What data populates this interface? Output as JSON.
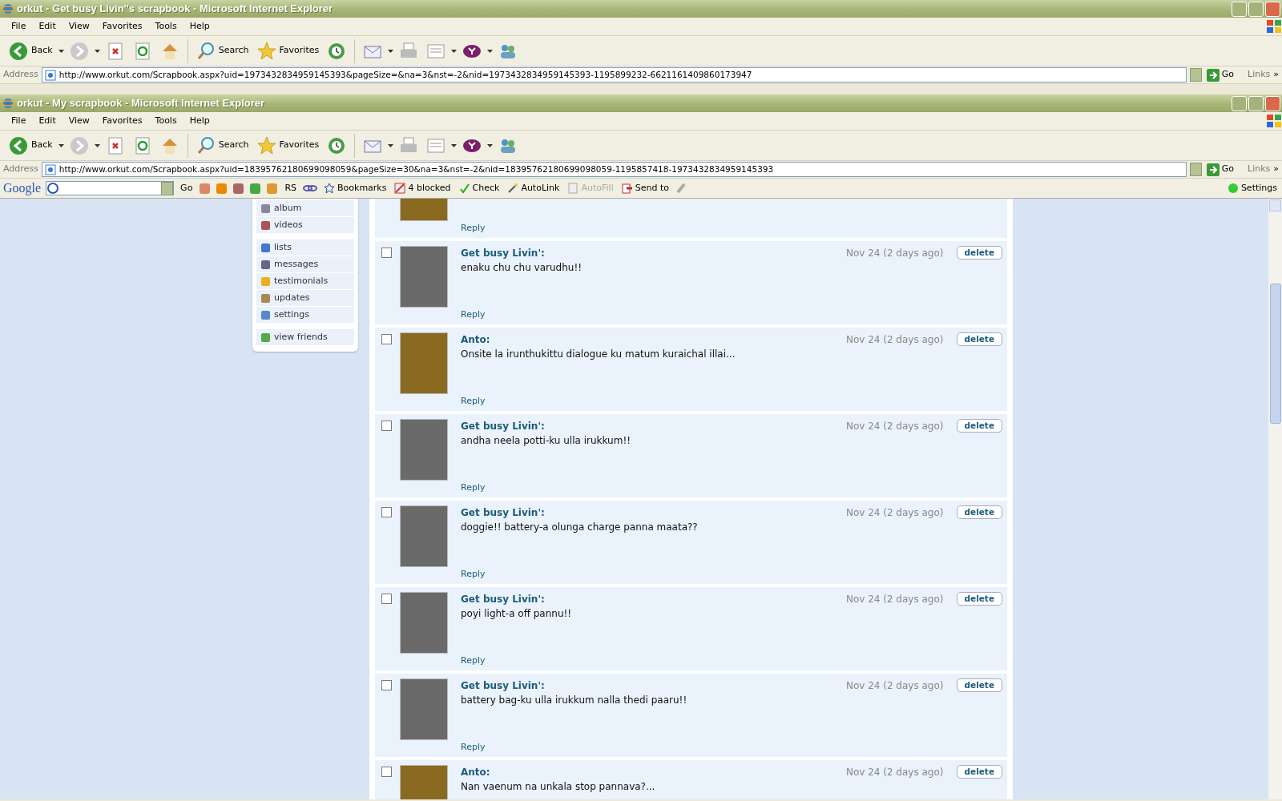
{
  "windows": [
    {
      "title": "orkut - Get busy Livin''s scrapbook - Microsoft Internet Explorer",
      "menu": [
        "File",
        "Edit",
        "View",
        "Favorites",
        "Tools",
        "Help"
      ],
      "toolbar": [
        {
          "kind": "back",
          "label": "Back"
        },
        {
          "kind": "forward"
        },
        {
          "kind": "stop"
        },
        {
          "kind": "refresh"
        },
        {
          "kind": "home"
        },
        {
          "kind": "search",
          "label": "Search"
        },
        {
          "kind": "favorites",
          "label": "Favorites"
        },
        {
          "kind": "history"
        },
        {
          "kind": "mail"
        },
        {
          "kind": "print"
        },
        {
          "kind": "edit"
        },
        {
          "kind": "yahoo"
        },
        {
          "kind": "messenger"
        }
      ],
      "address": {
        "label": "Address",
        "url": "http://www.orkut.com/Scrapbook.aspx?uid=1973432834959145393&pageSize=&na=3&nst=-2&nid=1973432834959145393-1195899232-6621161409860173947",
        "go": "Go",
        "links": "Links",
        "more": "»"
      }
    },
    {
      "title": "orkut - My scrapbook - Microsoft Internet Explorer",
      "menu": [
        "File",
        "Edit",
        "View",
        "Favorites",
        "Tools",
        "Help"
      ],
      "toolbar": [
        {
          "kind": "back",
          "label": "Back"
        },
        {
          "kind": "forward"
        },
        {
          "kind": "stop"
        },
        {
          "kind": "refresh"
        },
        {
          "kind": "home"
        },
        {
          "kind": "search",
          "label": "Search"
        },
        {
          "kind": "favorites",
          "label": "Favorites"
        },
        {
          "kind": "history"
        },
        {
          "kind": "mail"
        },
        {
          "kind": "print"
        },
        {
          "kind": "edit"
        },
        {
          "kind": "yahoo"
        },
        {
          "kind": "messenger"
        }
      ],
      "address": {
        "label": "Address",
        "url": "http://www.orkut.com/Scrapbook.aspx?uid=18395762180699098059&pageSize=30&na=3&nst=-2&nid=18395762180699098059-1195857418-1973432834959145393",
        "go": "Go",
        "links": "Links",
        "more": "»"
      }
    }
  ],
  "google_toolbar": {
    "logo": "Google",
    "go": "Go",
    "rs": "RS",
    "items": [
      {
        "kind": "bookmarks",
        "label": "Bookmarks",
        "disabled": false
      },
      {
        "kind": "blocked",
        "label": "4 blocked",
        "disabled": false
      },
      {
        "kind": "check",
        "label": "Check",
        "disabled": false
      },
      {
        "kind": "autolink",
        "label": "AutoLink",
        "disabled": false
      },
      {
        "kind": "autofill",
        "label": "AutoFill",
        "disabled": true
      },
      {
        "kind": "sendto",
        "label": "Send to",
        "disabled": false
      }
    ],
    "settings": "Settings"
  },
  "sidebar": [
    {
      "items": [
        {
          "kind": "album",
          "label": "album"
        },
        {
          "kind": "videos",
          "label": "videos"
        }
      ]
    },
    {
      "items": [
        {
          "kind": "lists",
          "label": "lists"
        },
        {
          "kind": "messages",
          "label": "messages"
        },
        {
          "kind": "testimonials",
          "label": "testimonials"
        },
        {
          "kind": "updates",
          "label": "updates"
        },
        {
          "kind": "settings",
          "label": "settings"
        }
      ]
    },
    {
      "items": [
        {
          "kind": "friends",
          "label": "view friends"
        }
      ]
    }
  ],
  "scraps": [
    {
      "color": "#8a6a20",
      "reply": "Reply"
    },
    {
      "checked": false,
      "color": "#6a6a6a",
      "author": "Get busy Livin':",
      "text": "enaku chu chu varudhu!!",
      "date": "Nov 24 (2 days ago)",
      "delete": "delete",
      "reply": "Reply"
    },
    {
      "checked": false,
      "color": "#8a6a20",
      "author": "Anto:",
      "text": "Onsite la irunthukittu dialogue ku matum kuraichal illai...",
      "date": "Nov 24 (2 days ago)",
      "delete": "delete",
      "reply": "Reply"
    },
    {
      "checked": false,
      "color": "#6a6a6a",
      "author": "Get busy Livin':",
      "text": "andha neela potti-ku ulla irukkum!!",
      "date": "Nov 24 (2 days ago)",
      "delete": "delete",
      "reply": "Reply"
    },
    {
      "checked": false,
      "color": "#6a6a6a",
      "author": "Get busy Livin':",
      "text": "doggie!! battery-a olunga charge panna maata??",
      "date": "Nov 24 (2 days ago)",
      "delete": "delete",
      "reply": "Reply"
    },
    {
      "checked": false,
      "color": "#6a6a6a",
      "author": "Get busy Livin':",
      "text": "poyi light-a off pannu!!",
      "date": "Nov 24 (2 days ago)",
      "delete": "delete",
      "reply": "Reply"
    },
    {
      "checked": false,
      "color": "#6a6a6a",
      "author": "Get busy Livin':",
      "text": "battery bag-ku ulla irukkum nalla thedi paaru!!",
      "date": "Nov 24 (2 days ago)",
      "delete": "delete",
      "reply": "Reply"
    },
    {
      "checked": false,
      "color": "#8a6a20",
      "author": "Anto:",
      "text": "Nan vaenum na unkala stop pannava?...",
      "date": "Nov 24 (2 days ago)",
      "delete": "delete"
    }
  ]
}
